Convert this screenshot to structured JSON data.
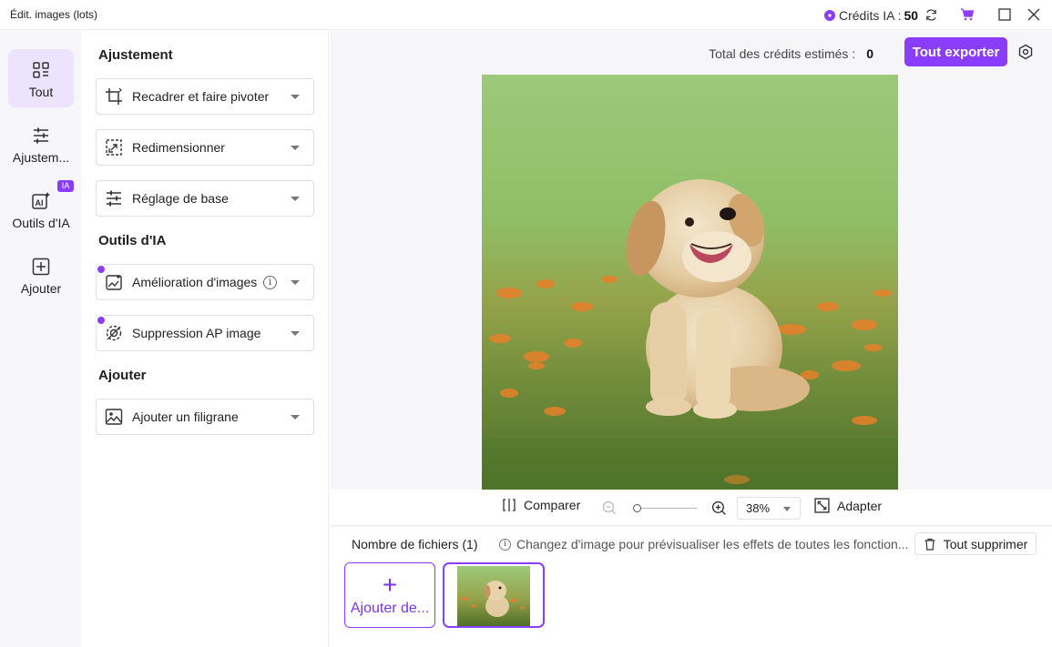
{
  "app": {
    "title": "Édit. images (lots)",
    "credits_label": "Crédits IA :",
    "credits_value": "50",
    "accent": "#8b3dff"
  },
  "rail": {
    "items": [
      {
        "label": "Tout",
        "icon": "grid-icon",
        "active": true
      },
      {
        "label": "Ajustem...",
        "icon": "sliders-icon"
      },
      {
        "label": "Outils d'IA",
        "icon": "ai-icon",
        "badge": "IA"
      },
      {
        "label": "Ajouter",
        "icon": "add-square-icon"
      }
    ]
  },
  "panel": {
    "sections": [
      {
        "title": "Ajustement",
        "tools": [
          {
            "label": "Recadrer et faire pivoter",
            "icon": "crop-icon"
          },
          {
            "label": "Redimensionner",
            "icon": "resize-icon"
          },
          {
            "label": "Réglage de base",
            "icon": "sliders-icon"
          }
        ]
      },
      {
        "title": "Outils d'IA",
        "tools": [
          {
            "label": "Amélioration d'images",
            "icon": "enhance-icon"
          },
          {
            "label": "Suppression AP image",
            "icon": "remove-bg-icon"
          }
        ]
      },
      {
        "title": "Ajouter",
        "tools": [
          {
            "label": "Ajouter un filigrane",
            "icon": "watermark-icon"
          }
        ]
      }
    ]
  },
  "header": {
    "total_label": "Total des crédits estimés :",
    "total_value": "0",
    "export_label": "Tout exporter"
  },
  "zoombar": {
    "compare_label": "Comparer",
    "zoom_value": "38%",
    "zoom_level": 0.0,
    "fit_label": "Adapter"
  },
  "files": {
    "count_label": "Nombre de fichiers (1)",
    "hint": "Changez d'image pour prévisualiser les effets de toutes les fonction...",
    "delete_label": "Tout supprimer",
    "add_label": "Ajouter de..."
  }
}
